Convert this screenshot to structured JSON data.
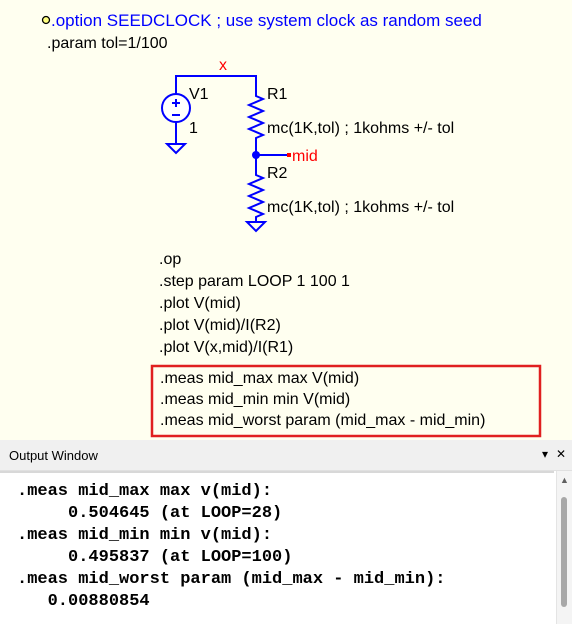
{
  "schematic": {
    "directives_top": [
      ".option SEEDCLOCK ; use system clock as random seed",
      ".param tol=1/100"
    ],
    "components": {
      "v1": {
        "name": "V1",
        "value": "1"
      },
      "r1": {
        "name": "R1",
        "value": "mc(1K,tol) ; 1kohms +/- tol"
      },
      "r2": {
        "name": "R2",
        "value": "mc(1K,tol) ; 1kohms +/- tol"
      }
    },
    "net_labels": {
      "x": "x",
      "mid": "mid"
    },
    "directives_mid": [
      ".op",
      ".step param LOOP 1 100 1",
      ".plot V(mid)",
      ".plot V(mid)/I(R2)",
      ".plot V(x,mid)/I(R1)"
    ],
    "meas_directives": [
      ".meas mid_max max V(mid)",
      ".meas mid_min min V(mid)",
      ".meas mid_worst param (mid_max - mid_min)"
    ]
  },
  "output_window": {
    "title": "Output Window",
    "lines": [
      ".meas mid_max max v(mid):",
      "     0.504645 (at LOOP=28)",
      ".meas mid_min min v(mid):",
      "     0.495837 (at LOOP=100)",
      ".meas mid_worst param (mid_max - mid_min):",
      "   0.00880854"
    ]
  },
  "colors": {
    "schematic_bg": "#fffff0",
    "wire": "#0000ff",
    "highlight_box": "#e02020",
    "net_label": "#ff0000",
    "directive_text": "#000000",
    "comment_text": "#0000ff"
  },
  "icons": {
    "pin": "directive-anchor-icon",
    "dropdown": "chevron-down-icon",
    "close": "close-icon",
    "scroll_up": "scroll-up-icon"
  }
}
